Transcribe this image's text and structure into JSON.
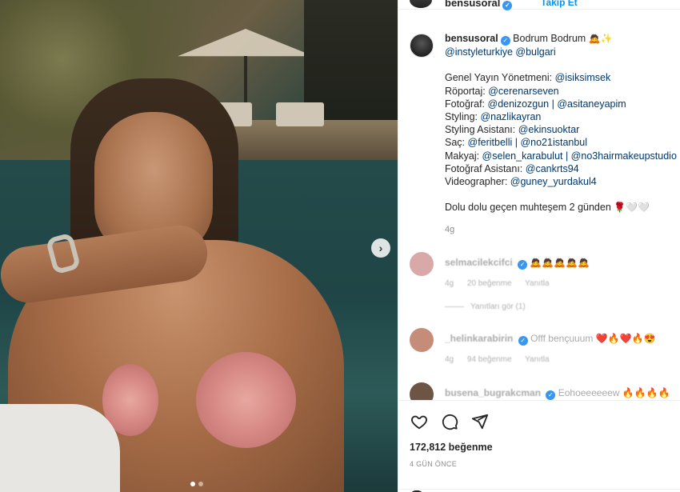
{
  "post": {
    "username": "bensusoral",
    "follow_label": "Takip Et",
    "caption": {
      "first_line": "Bodrum Bodrum",
      "first_line_emoji": "🙇✨",
      "mentions_line": "@instyleturkiye @bulgari",
      "credits": [
        {
          "label": "Genel Yayın Yönetmeni: ",
          "handle": "@isiksimsek"
        },
        {
          "label": "Röportaj: ",
          "handle": "@cerenarseven"
        },
        {
          "label": "Fotoğraf: ",
          "handle": "@denizozgun | @asitaneyapim"
        },
        {
          "label": "Styling: ",
          "handle": "@nazlikayran"
        },
        {
          "label": "Styling Asistanı: ",
          "handle": "@ekinsuoktar"
        },
        {
          "label": "Saç: ",
          "handle": "@feritbelli | @no21istanbul"
        },
        {
          "label": "Makyaj: ",
          "handle": "@selen_karabulut | @no3hairmakeupstudio"
        },
        {
          "label": "Fotoğraf Asistanı: ",
          "handle": "@cankrts94"
        },
        {
          "label": "Videographer: ",
          "handle": "@guney_yurdakul4"
        }
      ],
      "closing": "Dolu dolu geçen muhteşem 2 günden",
      "closing_emoji": "🌹🤍🤍",
      "age": "4g"
    },
    "comments": [
      {
        "user": "selmacilekcifci",
        "text": "",
        "emoji": "🙇🙇🙇🙇🙇",
        "time": "4g",
        "likes": "20 beğenme",
        "reply": "Yanıtla",
        "avatar_color": "#d9a9a9"
      },
      {
        "user": "_helinkarabirin",
        "text": "Offf bençuuum",
        "emoji": "❤️🔥❤️🔥😍",
        "time": "4g",
        "likes": "94 beğenme",
        "reply": "Yanıtla",
        "avatar_color": "#c58c7a"
      },
      {
        "user": "busena_bugrakcman",
        "text": "Eohoeeeeeew",
        "emoji": "🔥🔥🔥🔥",
        "time": "",
        "likes": "",
        "reply": "",
        "avatar_color": "#6d5445"
      }
    ],
    "view_replies": "Yanıtları gör (1)",
    "likes_count": "172,812 beğenme",
    "posted_when": "4 GÜN ÖNCE",
    "carousel": {
      "current": 1,
      "total": 2
    }
  }
}
